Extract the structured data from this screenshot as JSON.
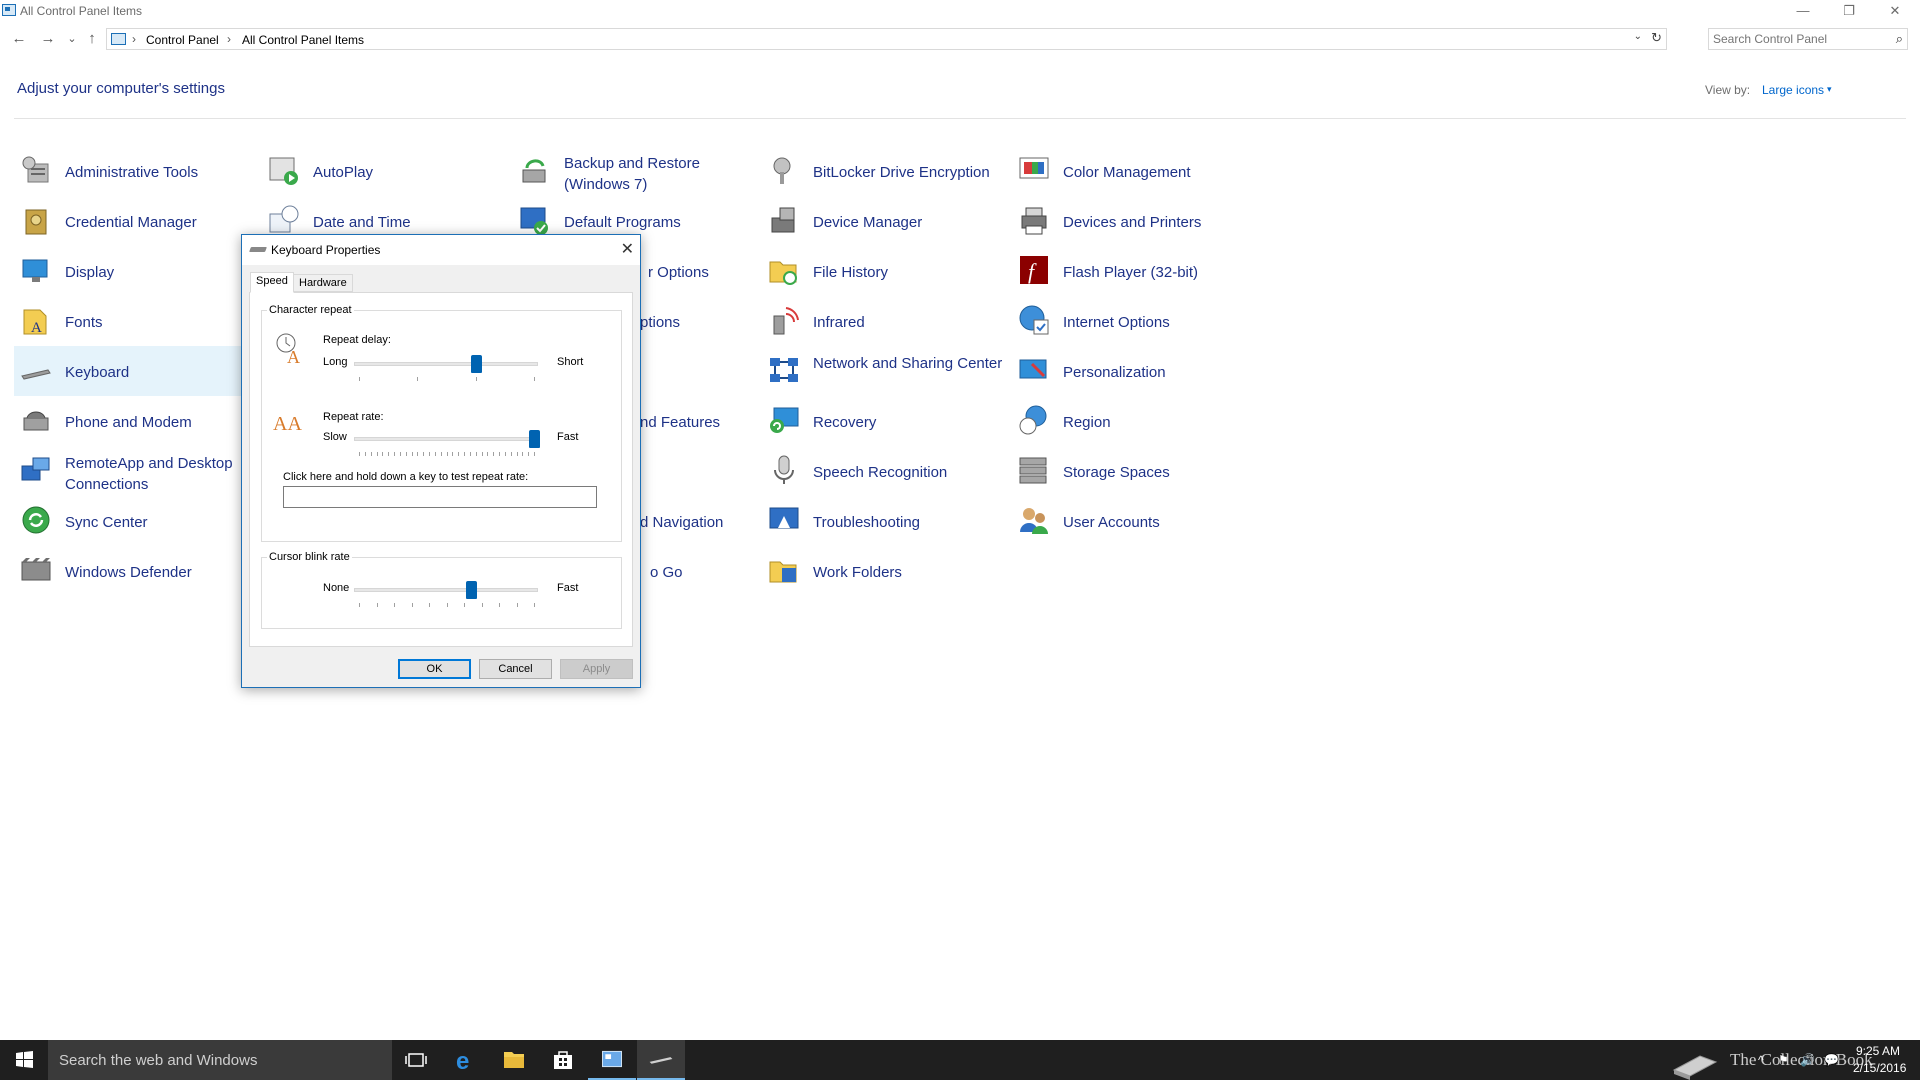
{
  "window": {
    "title": "All Control Panel Items",
    "minimize": "—",
    "restore": "❐",
    "close": "✕"
  },
  "nav": {
    "back": "←",
    "forward": "→",
    "recent": "⌄",
    "up": "↑",
    "breadcrumb": [
      "Control Panel",
      "All Control Panel Items"
    ],
    "separator": "›",
    "dropdown": "⌄",
    "refresh": "↻"
  },
  "search": {
    "placeholder": "Search Control Panel",
    "icon": "⌕"
  },
  "header": {
    "title": "Adjust your computer's settings",
    "view_by_label": "View by:",
    "view_by_value": "Large icons",
    "view_by_caret": "▾"
  },
  "items": {
    "c0": [
      "Administrative Tools",
      "Credential Manager",
      "Display",
      "Fonts",
      "Keyboard",
      "Phone and Modem",
      "RemoteApp and Desktop Connections",
      "Sync Center",
      "Windows Defender"
    ],
    "c1": [
      "AutoPlay",
      "Date and Time"
    ],
    "c2": [
      "Backup and Restore (Windows 7)",
      "Default Programs",
      "r Options",
      "ptions",
      "nd Features",
      "d Navigation",
      "o Go"
    ],
    "c3": [
      "BitLocker Drive Encryption",
      "Device Manager",
      "File History",
      "Infrared",
      "Network and Sharing Center",
      "Recovery",
      "Speech Recognition",
      "Troubleshooting",
      "Work Folders"
    ],
    "c4": [
      "Color Management",
      "Devices and Printers",
      "Flash Player (32-bit)",
      "Internet Options",
      "Personalization",
      "Region",
      "Storage Spaces",
      "User Accounts"
    ]
  },
  "dialog": {
    "title": "Keyboard Properties",
    "close": "✕",
    "tabs": [
      "Speed",
      "Hardware"
    ],
    "character_repeat": {
      "title": "Character repeat",
      "repeat_delay": {
        "label": "Repeat delay:",
        "min": "Long",
        "max": "Short",
        "value": 0.67
      },
      "repeat_rate": {
        "label": "Repeat rate:",
        "min": "Slow",
        "max": "Fast",
        "value": 1.0
      },
      "test_label": "Click here and hold down a key to test repeat rate:"
    },
    "cursor_blink": {
      "title": "Cursor blink rate",
      "min": "None",
      "max": "Fast",
      "value": 0.64
    },
    "buttons": {
      "ok": "OK",
      "cancel": "Cancel",
      "apply": "Apply"
    }
  },
  "taskbar": {
    "search_text": "Search the web and Windows",
    "watermark": "The Collection Book",
    "time": "9:25 AM",
    "date": "2/15/2016",
    "tray": [
      "^",
      "⚑",
      "🔊",
      "💬"
    ]
  },
  "colors": {
    "accent": "#0063b1",
    "link": "#1e3287",
    "taskbar": "#1f1f1f"
  }
}
